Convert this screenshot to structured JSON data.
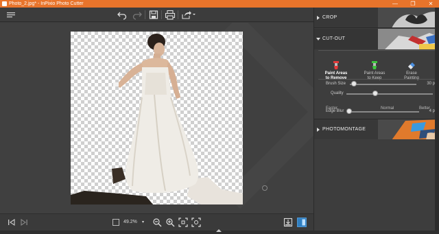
{
  "window": {
    "title": "Photo_2.jpg* - InPixio Photo Cutter",
    "minimize": "—",
    "maximize": "❐",
    "close": "✕"
  },
  "toolbar": {
    "icons": [
      "menu-icon",
      "undo-icon",
      "redo-icon",
      "save-icon",
      "print-icon",
      "share-icon"
    ]
  },
  "bottombar": {
    "zoom_value": "49.2%",
    "zoom_arrow": "▾"
  },
  "panel": {
    "crop_label": "CROP",
    "cutout_label": "CUT-OUT",
    "photomontage_label": "PHOTOMONTAGE",
    "tools": [
      {
        "label_line1": "Paint Areas",
        "label_line2": "to Remove",
        "color": "#e23a3a"
      },
      {
        "label_line1": "Paint Areas",
        "label_line2": "to Keep",
        "color": "#3ec43e"
      },
      {
        "label_line1": "Erase",
        "label_line2": "Painting",
        "color": "#4a8fe0"
      }
    ],
    "brush_size": {
      "label": "Brush Size",
      "value": "30 px",
      "level": 0.06
    },
    "quality": {
      "label": "Quality",
      "faster": "Faster",
      "normal": "Normal",
      "better": "Better",
      "level": 0.33
    },
    "edge_blur": {
      "label": "Edge Blur",
      "value": "4 px",
      "level": 0.03
    }
  },
  "colors": {
    "accent": "#e8742b",
    "panel_bg": "#3d3d3d",
    "canvas_bg": "#404040"
  }
}
